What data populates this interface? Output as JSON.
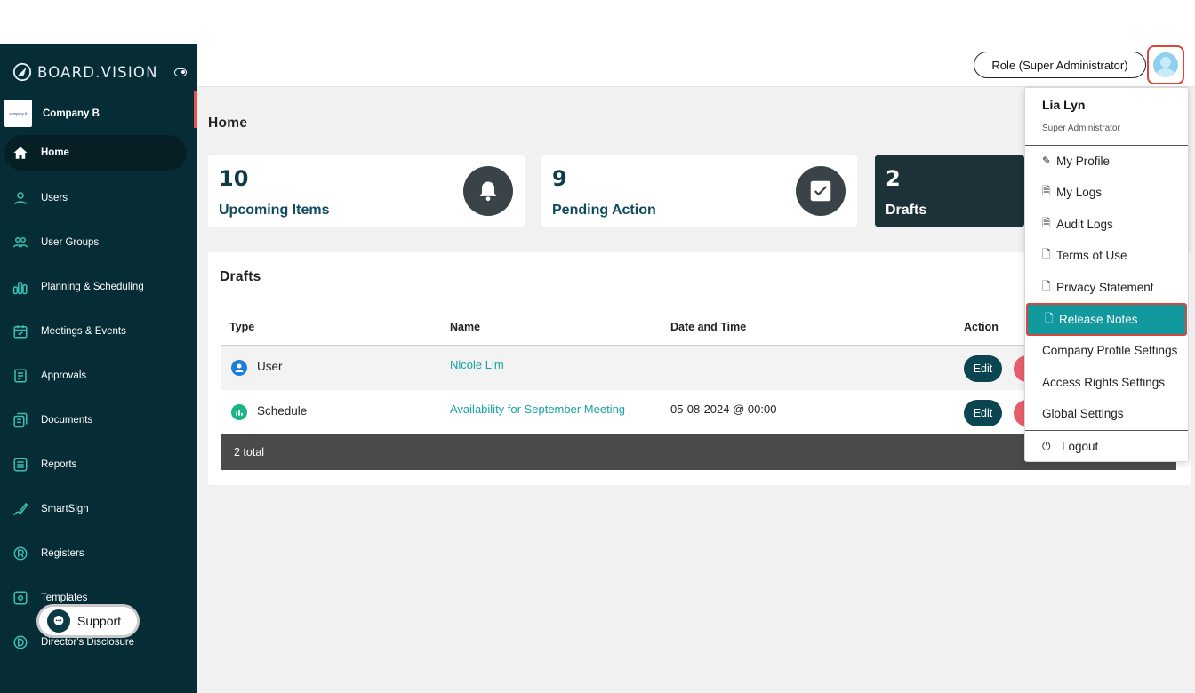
{
  "brand": {
    "name": "BOARD.VISION"
  },
  "company": {
    "name": "Company B",
    "logo_text": "company B"
  },
  "sidebar": {
    "items": [
      {
        "label": "Home",
        "icon": "home-icon"
      },
      {
        "label": "Users",
        "icon": "user-icon"
      },
      {
        "label": "User Groups",
        "icon": "user-groups-icon"
      },
      {
        "label": "Planning & Scheduling",
        "icon": "bar-chart-icon"
      },
      {
        "label": "Meetings & Events",
        "icon": "calendar-icon"
      },
      {
        "label": "Approvals",
        "icon": "approvals-icon"
      },
      {
        "label": "Documents",
        "icon": "documents-icon"
      },
      {
        "label": "Reports",
        "icon": "reports-icon"
      },
      {
        "label": "SmartSign",
        "icon": "pen-icon"
      },
      {
        "label": "Registers",
        "icon": "registers-icon"
      },
      {
        "label": "Templates",
        "icon": "templates-icon"
      },
      {
        "label": "Director's Disclosure",
        "icon": "disclosure-icon"
      }
    ],
    "support_label": "Support"
  },
  "header": {
    "role_label": "Role (Super Administrator)"
  },
  "page": {
    "title": "Home"
  },
  "stats": [
    {
      "value": "10",
      "label": "Upcoming Items",
      "icon": "bell-icon"
    },
    {
      "value": "9",
      "label": "Pending Action",
      "icon": "checkbox-icon"
    },
    {
      "value": "2",
      "label": "Drafts"
    }
  ],
  "drafts": {
    "title": "Drafts",
    "columns": [
      "Type",
      "Name",
      "Date and Time",
      "Action"
    ],
    "rows": [
      {
        "type": "User",
        "name": "Nicole Lim",
        "datetime": "",
        "edit": "Edit"
      },
      {
        "type": "Schedule",
        "name": "Availability for September Meeting",
        "datetime": "05-08-2024 @ 00:00",
        "edit": "Edit"
      }
    ],
    "total": "2 total"
  },
  "profile_menu": {
    "name": "Lia Lyn",
    "role": "Super Administrator",
    "items": [
      {
        "label": "My Profile",
        "icon": "edit-icon"
      },
      {
        "label": "My Logs",
        "icon": "doc-lines-icon"
      },
      {
        "label": "Audit Logs",
        "icon": "doc-lines-icon"
      },
      {
        "label": "Terms of Use",
        "icon": "doc-icon"
      },
      {
        "label": "Privacy Statement",
        "icon": "doc-icon"
      },
      {
        "label": "Release Notes",
        "icon": "doc-icon"
      },
      {
        "label": "Company Profile Settings"
      },
      {
        "label": "Access Rights Settings"
      },
      {
        "label": "Global Settings"
      },
      {
        "label": "Logout",
        "icon": "power-icon"
      }
    ]
  },
  "colors": {
    "sidebar_bg": "#062c35",
    "accent_teal": "#12999e",
    "highlight_red": "#d9463a"
  }
}
